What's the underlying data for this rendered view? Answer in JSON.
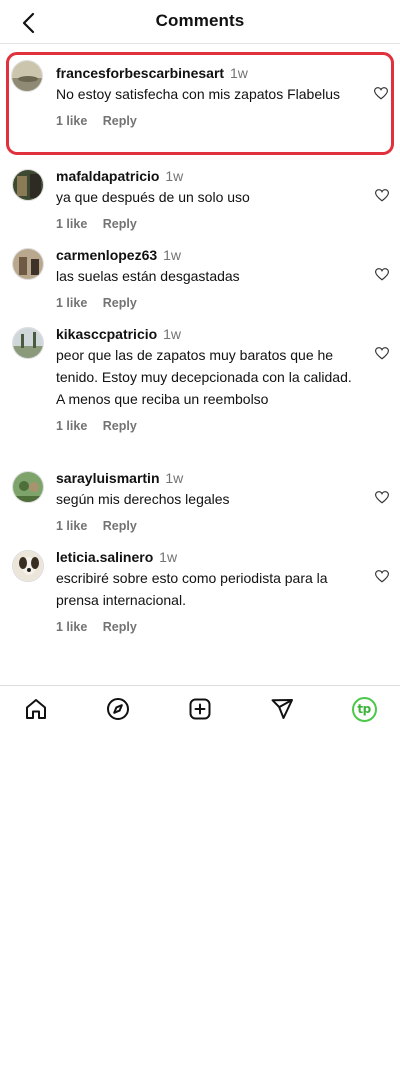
{
  "header": {
    "title": "Comments",
    "back_icon": "chevron-left-icon"
  },
  "comments": [
    {
      "username": "francesforbescarbinesart",
      "time": "1w",
      "text": "No estoy satisfecha con mis zapatos Flabelus",
      "likes": "1 like",
      "reply": "Reply",
      "highlighted": true,
      "avatar_colors": [
        "#c9c2aa",
        "#8f8a74",
        "#5f5b4a"
      ]
    },
    {
      "username": "mafaldapatricio",
      "time": "1w",
      "text": "ya que después de un solo uso",
      "likes": "1 like",
      "reply": "Reply",
      "highlighted": false,
      "avatar_colors": [
        "#3c4a2e",
        "#8a7a55",
        "#2c2a22"
      ]
    },
    {
      "username": "carmenlopez63",
      "time": "1w",
      "text": "las suelas están desgastadas",
      "likes": "1 like",
      "reply": "Reply",
      "highlighted": false,
      "avatar_colors": [
        "#b8a78c",
        "#6e5a44",
        "#3d3328"
      ]
    },
    {
      "username": "kikasccpatricio",
      "time": "1w",
      "text": "peor que las de zapatos muy baratos que he tenido. Estoy muy decepcionada con la calidad. A menos que reciba un reembolso",
      "likes": "1 like",
      "reply": "Reply",
      "highlighted": false,
      "avatar_colors": [
        "#cfd6d9",
        "#8a9a7a",
        "#4b5a3c"
      ]
    },
    {
      "username": "sarayluismartin",
      "time": "1w",
      "text": "según mis derechos legales",
      "likes": "1 like",
      "reply": "Reply",
      "highlighted": false,
      "avatar_colors": [
        "#7da26a",
        "#4e6e3a",
        "#a7946e"
      ]
    },
    {
      "username": "leticia.salinero",
      "time": "1w",
      "text": "escribiré sobre esto como periodista para la prensa internacional.",
      "likes": "1 like",
      "reply": "Reply",
      "highlighted": false,
      "avatar_colors": [
        "#e9e3d8",
        "#3a2e22",
        "#b58a5a"
      ]
    }
  ],
  "tabbar": {
    "items": [
      "home-icon",
      "explore-compass-icon",
      "create-plus-icon",
      "direct-send-icon",
      "profile-tp-icon"
    ],
    "profile_label": "tp"
  },
  "colors": {
    "highlight": "#e0313c",
    "meta": "#737373",
    "tp_logo": "#4cc94a"
  }
}
